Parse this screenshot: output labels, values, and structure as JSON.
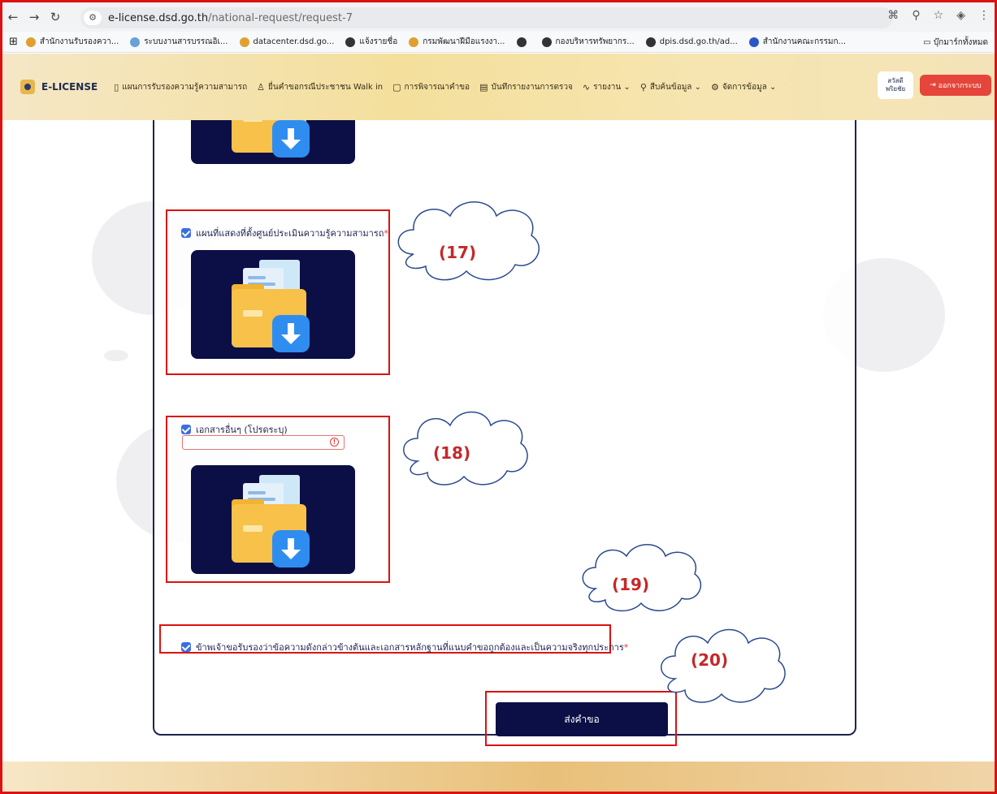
{
  "browser": {
    "url_host": "e-license.dsd.go.th",
    "url_path": "/national-request/request-7",
    "bookmarks": [
      {
        "label": "สำนักงานรับรองควา...",
        "color": "#e0a030"
      },
      {
        "label": "ระบบงานสารบรรณอิเ...",
        "color": "#6aa0d8"
      },
      {
        "label": "datacenter.dsd.go...",
        "color": "#e0a030"
      },
      {
        "label": "แจ้งรายชื่อ",
        "color": "#333333"
      },
      {
        "label": "กรมพัฒนาฝีมือแรงงา...",
        "color": "#e0a030"
      },
      {
        "label": "",
        "color": "#333333"
      },
      {
        "label": "กองบริหารทรัพยากร...",
        "color": "#333333"
      },
      {
        "label": "dpis.dsd.go.th/ad...",
        "color": "#333333"
      },
      {
        "label": "สำนักงานคณะกรรมก...",
        "color": "#2b57c6"
      }
    ],
    "all_bookmarks": "บุ๊กมาร์กทั้งหมด"
  },
  "header": {
    "logo": "E-LICENSE",
    "menu": [
      {
        "icon": "📖",
        "label": "แผนการรับรองความรู้ความสามารถ"
      },
      {
        "icon": "👤",
        "label": "ยื่นคำขอกรณีประชาชน Walk in"
      },
      {
        "icon": "📋",
        "label": "การพิจารณาคำขอ"
      },
      {
        "icon": "📄",
        "label": "บันทึกรายงานการตรวจ"
      },
      {
        "icon": "〽",
        "label": "รายงาน ⌄"
      },
      {
        "icon": "🔍",
        "label": "สืบค้นข้อมูล ⌄"
      },
      {
        "icon": "⚙",
        "label": "จัดการข้อมูล ⌄"
      }
    ],
    "greeting_line1": "สวัสดี",
    "greeting_line2": "พริยชัย",
    "logout_label": "ออกจากระบบ"
  },
  "form": {
    "map_label": "แผนที่แสดงที่ตั้งศูนย์ประเมินความรู้ความสามารถ",
    "other_docs_label": "เอกสารอื่นๆ (โปรดระบุ)",
    "other_docs_value": "",
    "confirm_label": "ข้าพเจ้าขอรับรองว่าข้อความดังกล่าวข้างต้นและเอกสารหลักฐานที่แนบคำขอถูกต้องและเป็นความจริงทุกประการ",
    "required_mark": "*",
    "submit_label": "ส่งคำขอ"
  },
  "annotations": {
    "c17": "(17)",
    "c18": "(18)",
    "c19": "(19)",
    "c20": "(20)"
  }
}
